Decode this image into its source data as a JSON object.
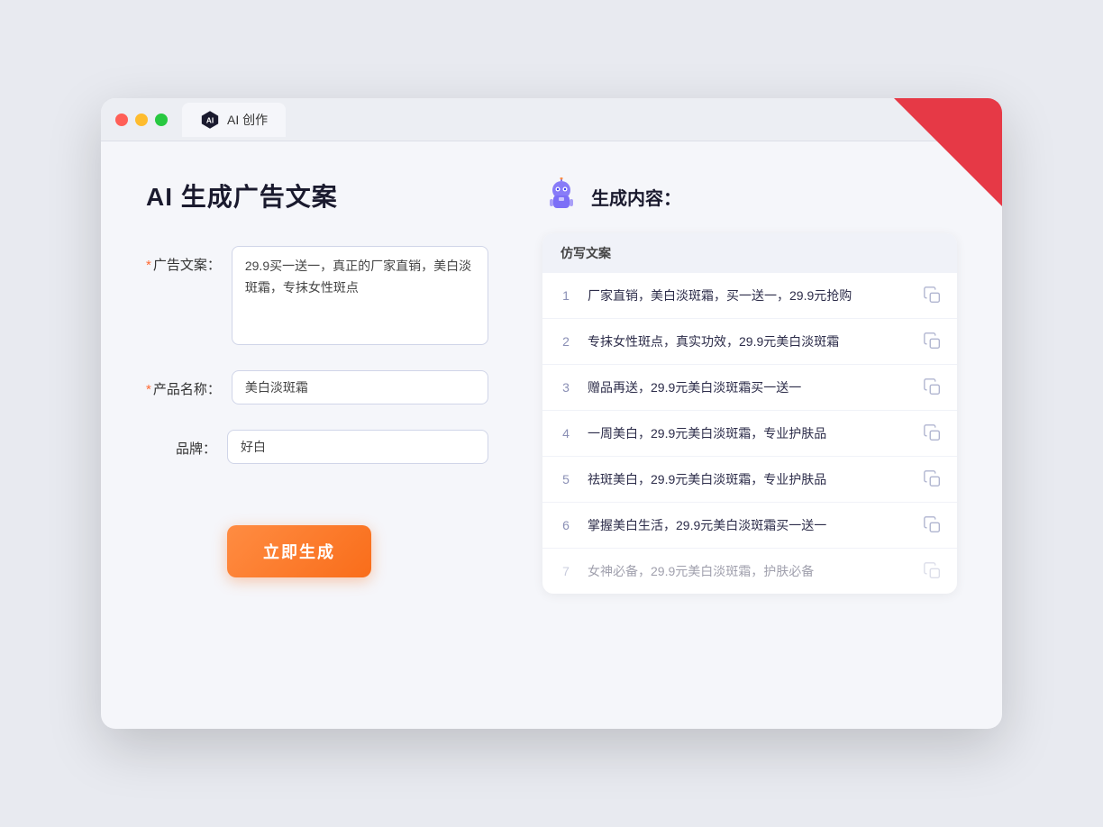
{
  "window": {
    "tab_label": "AI 创作"
  },
  "left_panel": {
    "title": "AI 生成广告文案",
    "form": {
      "ad_copy_label": "广告文案：",
      "ad_copy_required": "*",
      "ad_copy_value": "29.9买一送一，真正的厂家直销，美白淡斑霜，专抹女性斑点",
      "product_name_label": "产品名称：",
      "product_name_required": "*",
      "product_name_value": "美白淡斑霜",
      "brand_label": "品牌：",
      "brand_value": "好白"
    },
    "generate_button": "立即生成"
  },
  "right_panel": {
    "title": "生成内容：",
    "table_header": "仿写文案",
    "results": [
      {
        "num": "1",
        "text": "厂家直销，美白淡斑霜，买一送一，29.9元抢购",
        "faded": false
      },
      {
        "num": "2",
        "text": "专抹女性斑点，真实功效，29.9元美白淡斑霜",
        "faded": false
      },
      {
        "num": "3",
        "text": "赠品再送，29.9元美白淡斑霜买一送一",
        "faded": false
      },
      {
        "num": "4",
        "text": "一周美白，29.9元美白淡斑霜，专业护肤品",
        "faded": false
      },
      {
        "num": "5",
        "text": "祛斑美白，29.9元美白淡斑霜，专业护肤品",
        "faded": false
      },
      {
        "num": "6",
        "text": "掌握美白生活，29.9元美白淡斑霜买一送一",
        "faded": false
      },
      {
        "num": "7",
        "text": "女神必备，29.9元美白淡斑霜，护肤必备",
        "faded": true
      }
    ]
  }
}
